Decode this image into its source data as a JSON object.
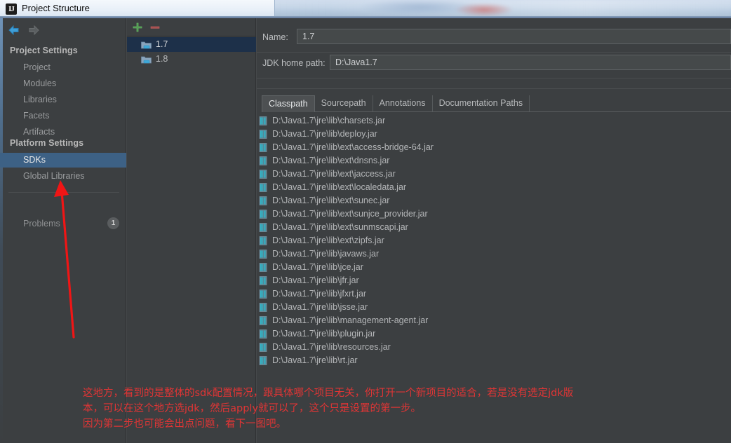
{
  "window": {
    "title": "Project Structure",
    "app_icon": "intellij-idea-icon"
  },
  "sidebar": {
    "nav": {
      "back_icon": "back-arrow-icon",
      "forward_icon": "forward-arrow-icon"
    },
    "sections": [
      {
        "header": "Project Settings",
        "items": [
          {
            "label": "Project",
            "selected": false
          },
          {
            "label": "Modules",
            "selected": false
          },
          {
            "label": "Libraries",
            "selected": false
          },
          {
            "label": "Facets",
            "selected": false
          },
          {
            "label": "Artifacts",
            "selected": false
          }
        ]
      },
      {
        "header": "Platform Settings",
        "items": [
          {
            "label": "SDKs",
            "selected": true
          },
          {
            "label": "Global Libraries",
            "selected": false
          }
        ]
      }
    ],
    "problems": {
      "label": "Problems",
      "count": "1"
    }
  },
  "sdk_panel": {
    "toolbar": {
      "add_label": "+",
      "remove_label": "–"
    },
    "items": [
      {
        "name": "1.7",
        "selected": true,
        "icon": "sdk-folder-icon"
      },
      {
        "name": "1.8",
        "selected": false,
        "icon": "sdk-folder-icon"
      }
    ]
  },
  "detail": {
    "name_label": "Name:",
    "name_value": "1.7",
    "home_label": "JDK home path:",
    "home_value": "D:\\Java1.7",
    "tabs": [
      {
        "label": "Classpath",
        "active": true
      },
      {
        "label": "Sourcepath",
        "active": false
      },
      {
        "label": "Annotations",
        "active": false
      },
      {
        "label": "Documentation Paths",
        "active": false
      }
    ],
    "classpath": [
      "D:\\Java1.7\\jre\\lib\\charsets.jar",
      "D:\\Java1.7\\jre\\lib\\deploy.jar",
      "D:\\Java1.7\\jre\\lib\\ext\\access-bridge-64.jar",
      "D:\\Java1.7\\jre\\lib\\ext\\dnsns.jar",
      "D:\\Java1.7\\jre\\lib\\ext\\jaccess.jar",
      "D:\\Java1.7\\jre\\lib\\ext\\localedata.jar",
      "D:\\Java1.7\\jre\\lib\\ext\\sunec.jar",
      "D:\\Java1.7\\jre\\lib\\ext\\sunjce_provider.jar",
      "D:\\Java1.7\\jre\\lib\\ext\\sunmscapi.jar",
      "D:\\Java1.7\\jre\\lib\\ext\\zipfs.jar",
      "D:\\Java1.7\\jre\\lib\\javaws.jar",
      "D:\\Java1.7\\jre\\lib\\jce.jar",
      "D:\\Java1.7\\jre\\lib\\jfr.jar",
      "D:\\Java1.7\\jre\\lib\\jfxrt.jar",
      "D:\\Java1.7\\jre\\lib\\jsse.jar",
      "D:\\Java1.7\\jre\\lib\\management-agent.jar",
      "D:\\Java1.7\\jre\\lib\\plugin.jar",
      "D:\\Java1.7\\jre\\lib\\resources.jar",
      "D:\\Java1.7\\jre\\lib\\rt.jar"
    ]
  },
  "annotation": {
    "line1": "这地方，看到的是整体的sdk配置情况，跟具体哪个项目无关，你打开一个新项目的适合，若是没有选定jdk版",
    "line2": "本，可以在这个地方选jdk，然后apply就可以了，这个只是设置的第一步。",
    "line3": "因为第二步也可能会出点问题，看下一图吧。",
    "color": "#e03535",
    "arrow": "red-arrow-pointing-to-sdks"
  }
}
